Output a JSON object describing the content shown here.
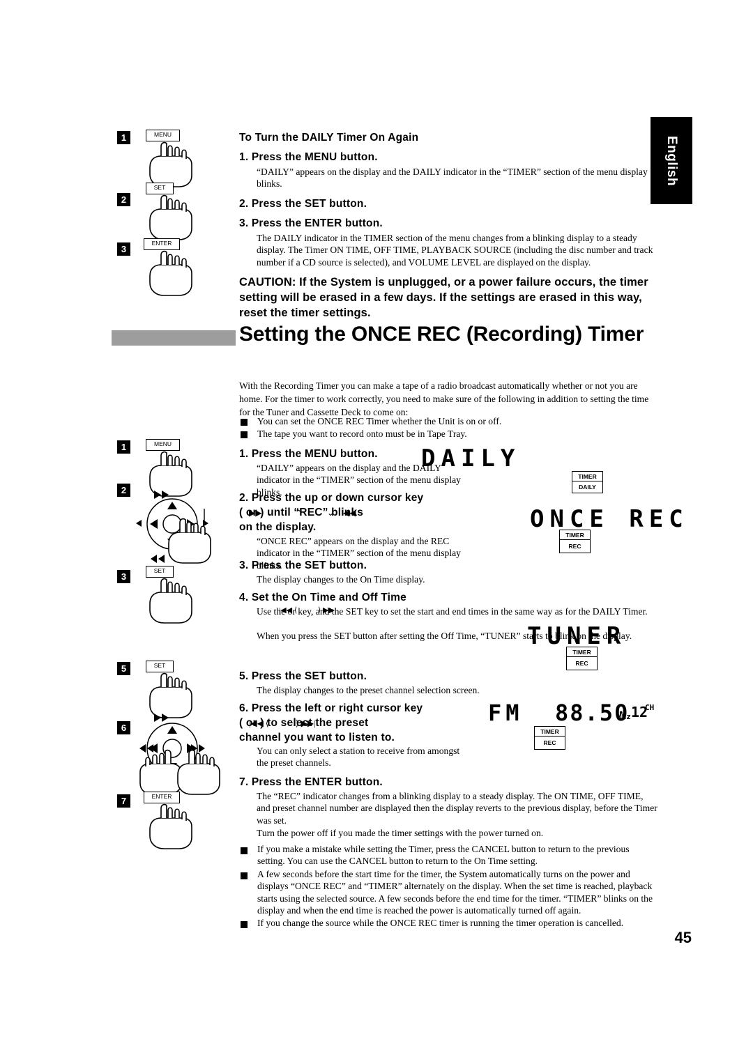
{
  "side_tab": {
    "label": "English"
  },
  "page_number": "45",
  "top_section": {
    "heading": "To Turn the DAILY Timer On Again",
    "steps": [
      {
        "num": "1",
        "key": "MENU",
        "title": "1. Press the MENU button.",
        "body": "“DAILY” appears on the display and the DAILY indicator in the “TIMER” section of the menu display blinks."
      },
      {
        "num": "2",
        "key": "SET",
        "title": "2. Press the SET button.",
        "body": ""
      },
      {
        "num": "3",
        "key": "ENTER",
        "title": "3. Press the ENTER button.",
        "body": "The DAILY indicator in the TIMER section of the menu changes from a blinking display to a steady display. The Timer ON TIME, OFF TIME, PLAYBACK SOURCE (including the disc number and track number if a CD source is selected), and VOLUME LEVEL are displayed on the display."
      }
    ],
    "caution": "CAUTION: If the System is unplugged, or a power failure occurs, the timer setting will be erased in a few days. If the settings are erased in this way, reset the timer settings."
  },
  "section": {
    "title": "Setting the ONCE REC (Recording) Timer",
    "intro": "With the Recording Timer you can make a tape of a radio broadcast automatically whether or not you are home. For the timer to work correctly, you need to make sure of the following in addition to setting the time for the Tuner and Cassette Deck to come on:",
    "bullets": [
      "You can set the ONCE REC Timer whether the Unit is on or off.",
      "The tape you want to record onto must be in Tape Tray."
    ]
  },
  "steps": [
    {
      "num": "1",
      "key": "MENU",
      "title": "1. Press the MENU button.",
      "body": "“DAILY” appears on the display and the DAILY indicator in the “TIMER” section of the menu display blinks."
    },
    {
      "num": "2",
      "key": "",
      "title_line1": "2. Press the up or down cursor key",
      "title_line2": "(   or    ) until “REC” blinks",
      "title_line3": "on the display.",
      "body": "“ONCE REC” appears on the display and the REC indicator in the “TIMER” section of the menu display blinks."
    },
    {
      "num": "3",
      "key": "SET",
      "title": "3. Press the SET button.",
      "body": "The display changes to the On Time display."
    },
    {
      "num": "4",
      "key": "",
      "title": "4. Set the On Time and Off Time",
      "body1": "Use the          or        key, and the SET key to set the start and end times in the same way as for the DAILY Timer.",
      "body2": "When you press the SET button after setting the Off Time, “TUNER” starts to blink on the display."
    },
    {
      "num": "5",
      "key": "SET",
      "title": "5. Press the SET button.",
      "body": "The display changes to the preset channel selection screen."
    },
    {
      "num": "6",
      "key": "",
      "title_line1": "6. Press the left or right cursor key",
      "title_line2": "(      or      ) to select the preset",
      "title_line3": "channel you want to listen to.",
      "body": "You can only select a station to receive from amongst the preset channels."
    },
    {
      "num": "7",
      "key": "ENTER",
      "title": "7. Press the ENTER button.",
      "body1": "The “REC” indicator changes from a blinking display to a steady display. The ON TIME, OFF TIME, and preset channel number are displayed then the display reverts to the previous display, before the Timer was set.",
      "body2": "Turn the power off if you made the timer settings with the power turned on."
    }
  ],
  "final_bullets": [
    "If you make a mistake while setting the Timer, press the CANCEL button to return to the previous setting. You can use the CANCEL button to return to the On Time setting.",
    "A few seconds before the start time for the timer, the System automatically turns on the power and displays “ONCE REC” and “TIMER” alternately on the display. When the set time is reached, playback starts using  the selected source. A few seconds before the end time for the timer. “TIMER” blinks on the display and when the end time is reached the power is automatically turned off again.",
    "If you change the source while the ONCE REC timer is running the timer operation is cancelled."
  ],
  "displays": [
    {
      "text": "DAILY",
      "indicator_top": "TIMER",
      "indicator_bottom": "DAILY"
    },
    {
      "text": "ONCE REC",
      "indicator_top": "TIMER",
      "indicator_bottom": "REC"
    },
    {
      "text": "TUNER",
      "indicator_top": "TIMER",
      "indicator_bottom": "REC"
    },
    {
      "text": "FM",
      "frequency": "88.50",
      "freq_unit": "MHz",
      "channel_num": "12",
      "channel_unit": "CH",
      "indicator_top": "TIMER",
      "indicator_bottom": "REC"
    }
  ]
}
